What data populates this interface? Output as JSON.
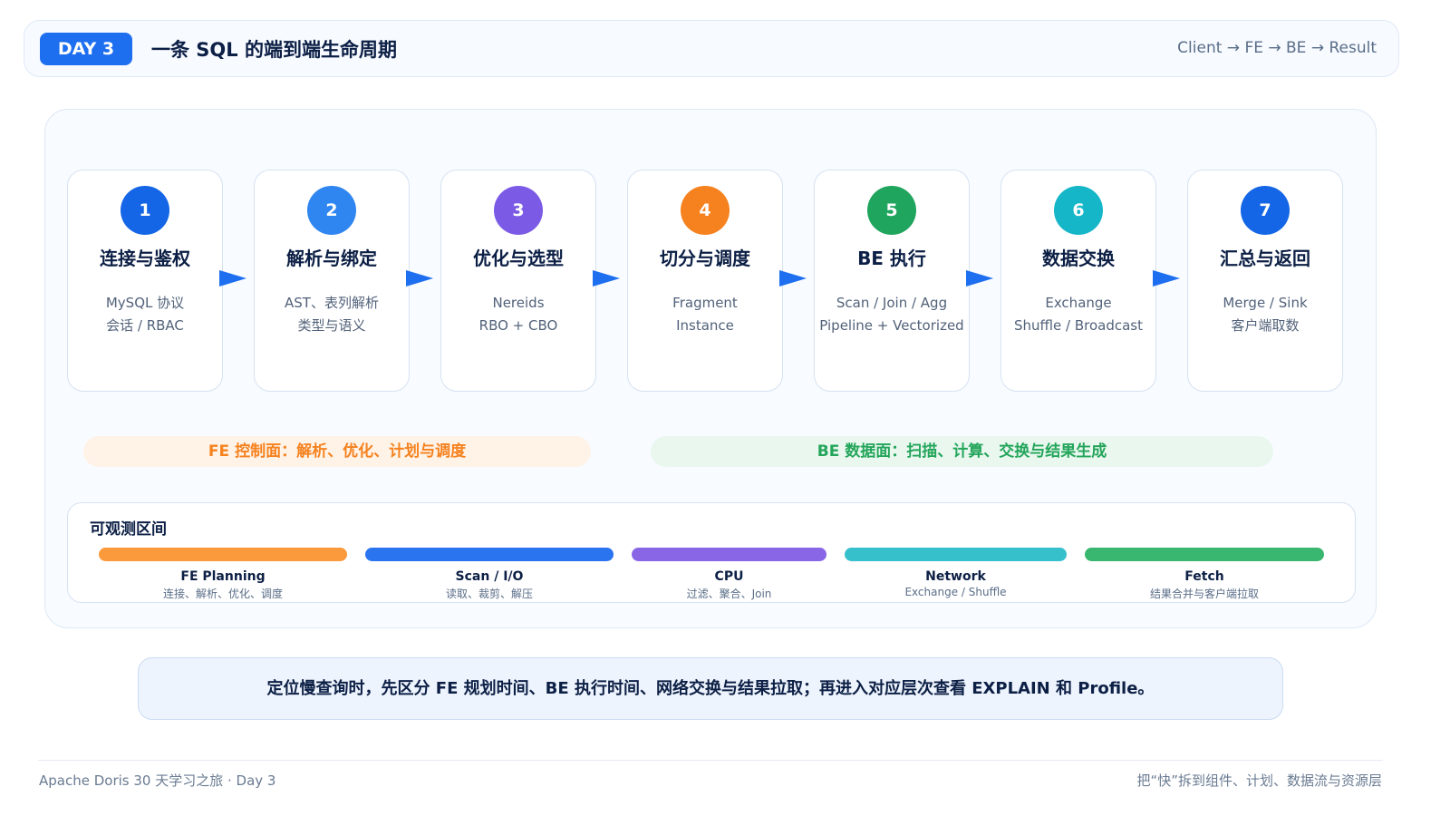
{
  "header": {
    "badge": "DAY 3",
    "title": "一条 SQL 的端到端生命周期",
    "route": "Client → FE → BE → Result"
  },
  "stages": [
    {
      "num": "1",
      "name": "连接与鉴权",
      "line1": "MySQL 协议",
      "line2": "会话 / RBAC",
      "color": "#1466e6"
    },
    {
      "num": "2",
      "name": "解析与绑定",
      "line1": "AST、表列解析",
      "line2": "类型与语义",
      "color": "#2f86f0"
    },
    {
      "num": "3",
      "name": "优化与选型",
      "line1": "Nereids",
      "line2": "RBO + CBO",
      "color": "#7b5be6"
    },
    {
      "num": "4",
      "name": "切分与调度",
      "line1": "Fragment",
      "line2": "Instance",
      "color": "#f5821f"
    },
    {
      "num": "5",
      "name": "BE 执行",
      "line1": "Scan / Join / Agg",
      "line2": "Pipeline + Vectorized",
      "color": "#1fa55e"
    },
    {
      "num": "6",
      "name": "数据交换",
      "line1": "Exchange",
      "line2": "Shuffle / Broadcast",
      "color": "#14b6c8"
    },
    {
      "num": "7",
      "name": "汇总与返回",
      "line1": "Merge / Sink",
      "line2": "客户端取数",
      "color": "#1466e6"
    }
  ],
  "planes": {
    "fe": "FE 控制面：解析、优化、计划与调度",
    "be": "BE 数据面：扫描、计算、交换与结果生成"
  },
  "observability": {
    "title": "可观测区间",
    "segments": [
      {
        "label": "FE Planning",
        "sub": "连接、解析、优化、调度",
        "color": "#fb9a3c"
      },
      {
        "label": "Scan / I/O",
        "sub": "读取、裁剪、解压",
        "color": "#2a74f0"
      },
      {
        "label": "CPU",
        "sub": "过滤、聚合、Join",
        "color": "#8866e6"
      },
      {
        "label": "Network",
        "sub": "Exchange / Shuffle",
        "color": "#36c0cc"
      },
      {
        "label": "Fetch",
        "sub": "结果合并与客户端拉取",
        "color": "#39b66f"
      }
    ]
  },
  "note": "定位慢查询时，先区分 FE 规划时间、BE 执行时间、网络交换与结果拉取；再进入对应层次查看 EXPLAIN 和 Profile。",
  "footer": {
    "left": "Apache Doris 30 天学习之旅 · Day 3",
    "right": "把“快”拆到组件、计划、数据流与资源层"
  }
}
